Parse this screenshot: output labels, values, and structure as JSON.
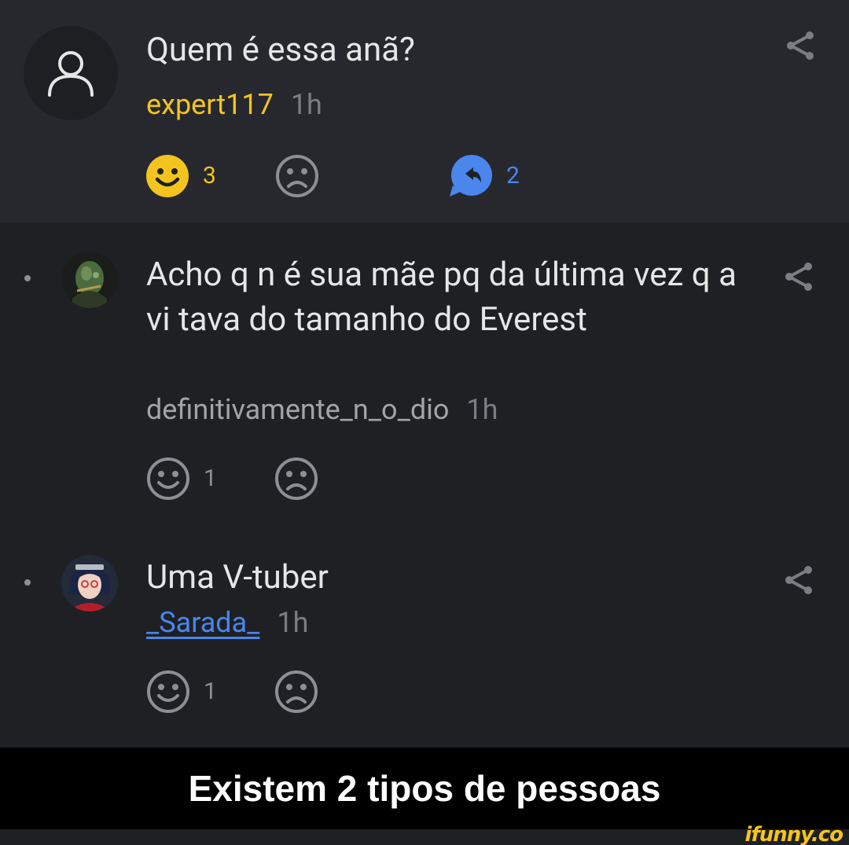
{
  "post": {
    "title": "Quem é essa anã?",
    "username": "expert117",
    "time": "1h",
    "like_count": "3",
    "reply_count": "2"
  },
  "comments": [
    {
      "text": "Acho q n é sua mãe pq da última vez q a vi tava do tamanho do Everest",
      "username": "definitivamente_n_o_dio",
      "time": "1h",
      "like_count": "1"
    },
    {
      "text": "Uma V-tuber",
      "username": "_Sarada_",
      "time": "1h",
      "like_count": "1"
    }
  ],
  "caption": "Existem 2 tipos de pessoas",
  "watermark": "ifunny.co",
  "colors": {
    "accent_yellow": "#f4c41e",
    "accent_blue": "#4a86ec",
    "background": "#1f2024",
    "post_background": "#27282d"
  },
  "icons": {
    "share": "share-icon",
    "smile": "smile-icon",
    "frown": "frown-icon",
    "reply": "reply-bubble-icon",
    "default_avatar": "user-icon"
  }
}
